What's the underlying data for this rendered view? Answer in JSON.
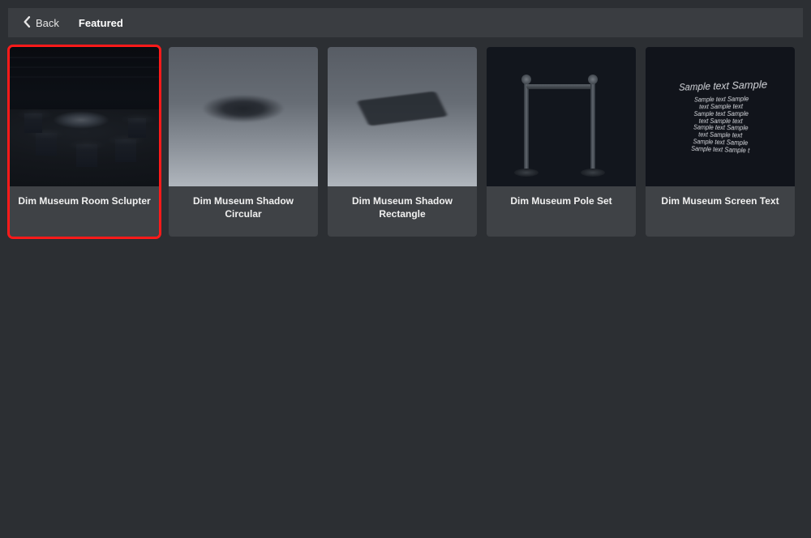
{
  "header": {
    "back_label": "Back",
    "title": "Featured"
  },
  "cards": [
    {
      "label": "Dim Museum Room Sclupter",
      "selected": true
    },
    {
      "label": "Dim Museum Shadow Circular",
      "selected": false
    },
    {
      "label": "Dim Museum Shadow Rectangle",
      "selected": false
    },
    {
      "label": "Dim Museum Pole Set",
      "selected": false
    },
    {
      "label": "Dim Museum Screen Text",
      "selected": false
    }
  ],
  "screen_text": {
    "headline": "Sample text Sample",
    "lines": [
      "Sample text Sample",
      "text Sample text",
      "Sample text Sample",
      "text Sample text",
      "Sample text Sample",
      "text Sample text",
      "Sample text Sample",
      "Sample text Sample t"
    ]
  }
}
